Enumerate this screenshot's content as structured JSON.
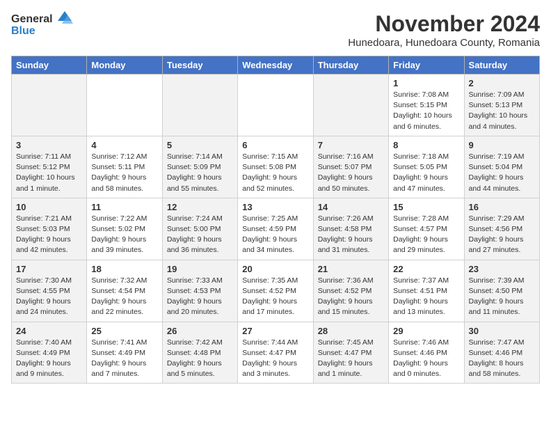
{
  "header": {
    "logo_line1": "General",
    "logo_line2": "Blue",
    "month_title": "November 2024",
    "location": "Hunedoara, Hunedoara County, Romania"
  },
  "weekdays": [
    "Sunday",
    "Monday",
    "Tuesday",
    "Wednesday",
    "Thursday",
    "Friday",
    "Saturday"
  ],
  "weeks": [
    [
      {
        "day": "",
        "info": ""
      },
      {
        "day": "",
        "info": ""
      },
      {
        "day": "",
        "info": ""
      },
      {
        "day": "",
        "info": ""
      },
      {
        "day": "",
        "info": ""
      },
      {
        "day": "1",
        "info": "Sunrise: 7:08 AM\nSunset: 5:15 PM\nDaylight: 10 hours and 6 minutes."
      },
      {
        "day": "2",
        "info": "Sunrise: 7:09 AM\nSunset: 5:13 PM\nDaylight: 10 hours and 4 minutes."
      }
    ],
    [
      {
        "day": "3",
        "info": "Sunrise: 7:11 AM\nSunset: 5:12 PM\nDaylight: 10 hours and 1 minute."
      },
      {
        "day": "4",
        "info": "Sunrise: 7:12 AM\nSunset: 5:11 PM\nDaylight: 9 hours and 58 minutes."
      },
      {
        "day": "5",
        "info": "Sunrise: 7:14 AM\nSunset: 5:09 PM\nDaylight: 9 hours and 55 minutes."
      },
      {
        "day": "6",
        "info": "Sunrise: 7:15 AM\nSunset: 5:08 PM\nDaylight: 9 hours and 52 minutes."
      },
      {
        "day": "7",
        "info": "Sunrise: 7:16 AM\nSunset: 5:07 PM\nDaylight: 9 hours and 50 minutes."
      },
      {
        "day": "8",
        "info": "Sunrise: 7:18 AM\nSunset: 5:05 PM\nDaylight: 9 hours and 47 minutes."
      },
      {
        "day": "9",
        "info": "Sunrise: 7:19 AM\nSunset: 5:04 PM\nDaylight: 9 hours and 44 minutes."
      }
    ],
    [
      {
        "day": "10",
        "info": "Sunrise: 7:21 AM\nSunset: 5:03 PM\nDaylight: 9 hours and 42 minutes."
      },
      {
        "day": "11",
        "info": "Sunrise: 7:22 AM\nSunset: 5:02 PM\nDaylight: 9 hours and 39 minutes."
      },
      {
        "day": "12",
        "info": "Sunrise: 7:24 AM\nSunset: 5:00 PM\nDaylight: 9 hours and 36 minutes."
      },
      {
        "day": "13",
        "info": "Sunrise: 7:25 AM\nSunset: 4:59 PM\nDaylight: 9 hours and 34 minutes."
      },
      {
        "day": "14",
        "info": "Sunrise: 7:26 AM\nSunset: 4:58 PM\nDaylight: 9 hours and 31 minutes."
      },
      {
        "day": "15",
        "info": "Sunrise: 7:28 AM\nSunset: 4:57 PM\nDaylight: 9 hours and 29 minutes."
      },
      {
        "day": "16",
        "info": "Sunrise: 7:29 AM\nSunset: 4:56 PM\nDaylight: 9 hours and 27 minutes."
      }
    ],
    [
      {
        "day": "17",
        "info": "Sunrise: 7:30 AM\nSunset: 4:55 PM\nDaylight: 9 hours and 24 minutes."
      },
      {
        "day": "18",
        "info": "Sunrise: 7:32 AM\nSunset: 4:54 PM\nDaylight: 9 hours and 22 minutes."
      },
      {
        "day": "19",
        "info": "Sunrise: 7:33 AM\nSunset: 4:53 PM\nDaylight: 9 hours and 20 minutes."
      },
      {
        "day": "20",
        "info": "Sunrise: 7:35 AM\nSunset: 4:52 PM\nDaylight: 9 hours and 17 minutes."
      },
      {
        "day": "21",
        "info": "Sunrise: 7:36 AM\nSunset: 4:52 PM\nDaylight: 9 hours and 15 minutes."
      },
      {
        "day": "22",
        "info": "Sunrise: 7:37 AM\nSunset: 4:51 PM\nDaylight: 9 hours and 13 minutes."
      },
      {
        "day": "23",
        "info": "Sunrise: 7:39 AM\nSunset: 4:50 PM\nDaylight: 9 hours and 11 minutes."
      }
    ],
    [
      {
        "day": "24",
        "info": "Sunrise: 7:40 AM\nSunset: 4:49 PM\nDaylight: 9 hours and 9 minutes."
      },
      {
        "day": "25",
        "info": "Sunrise: 7:41 AM\nSunset: 4:49 PM\nDaylight: 9 hours and 7 minutes."
      },
      {
        "day": "26",
        "info": "Sunrise: 7:42 AM\nSunset: 4:48 PM\nDaylight: 9 hours and 5 minutes."
      },
      {
        "day": "27",
        "info": "Sunrise: 7:44 AM\nSunset: 4:47 PM\nDaylight: 9 hours and 3 minutes."
      },
      {
        "day": "28",
        "info": "Sunrise: 7:45 AM\nSunset: 4:47 PM\nDaylight: 9 hours and 1 minute."
      },
      {
        "day": "29",
        "info": "Sunrise: 7:46 AM\nSunset: 4:46 PM\nDaylight: 9 hours and 0 minutes."
      },
      {
        "day": "30",
        "info": "Sunrise: 7:47 AM\nSunset: 4:46 PM\nDaylight: 8 hours and 58 minutes."
      }
    ]
  ]
}
